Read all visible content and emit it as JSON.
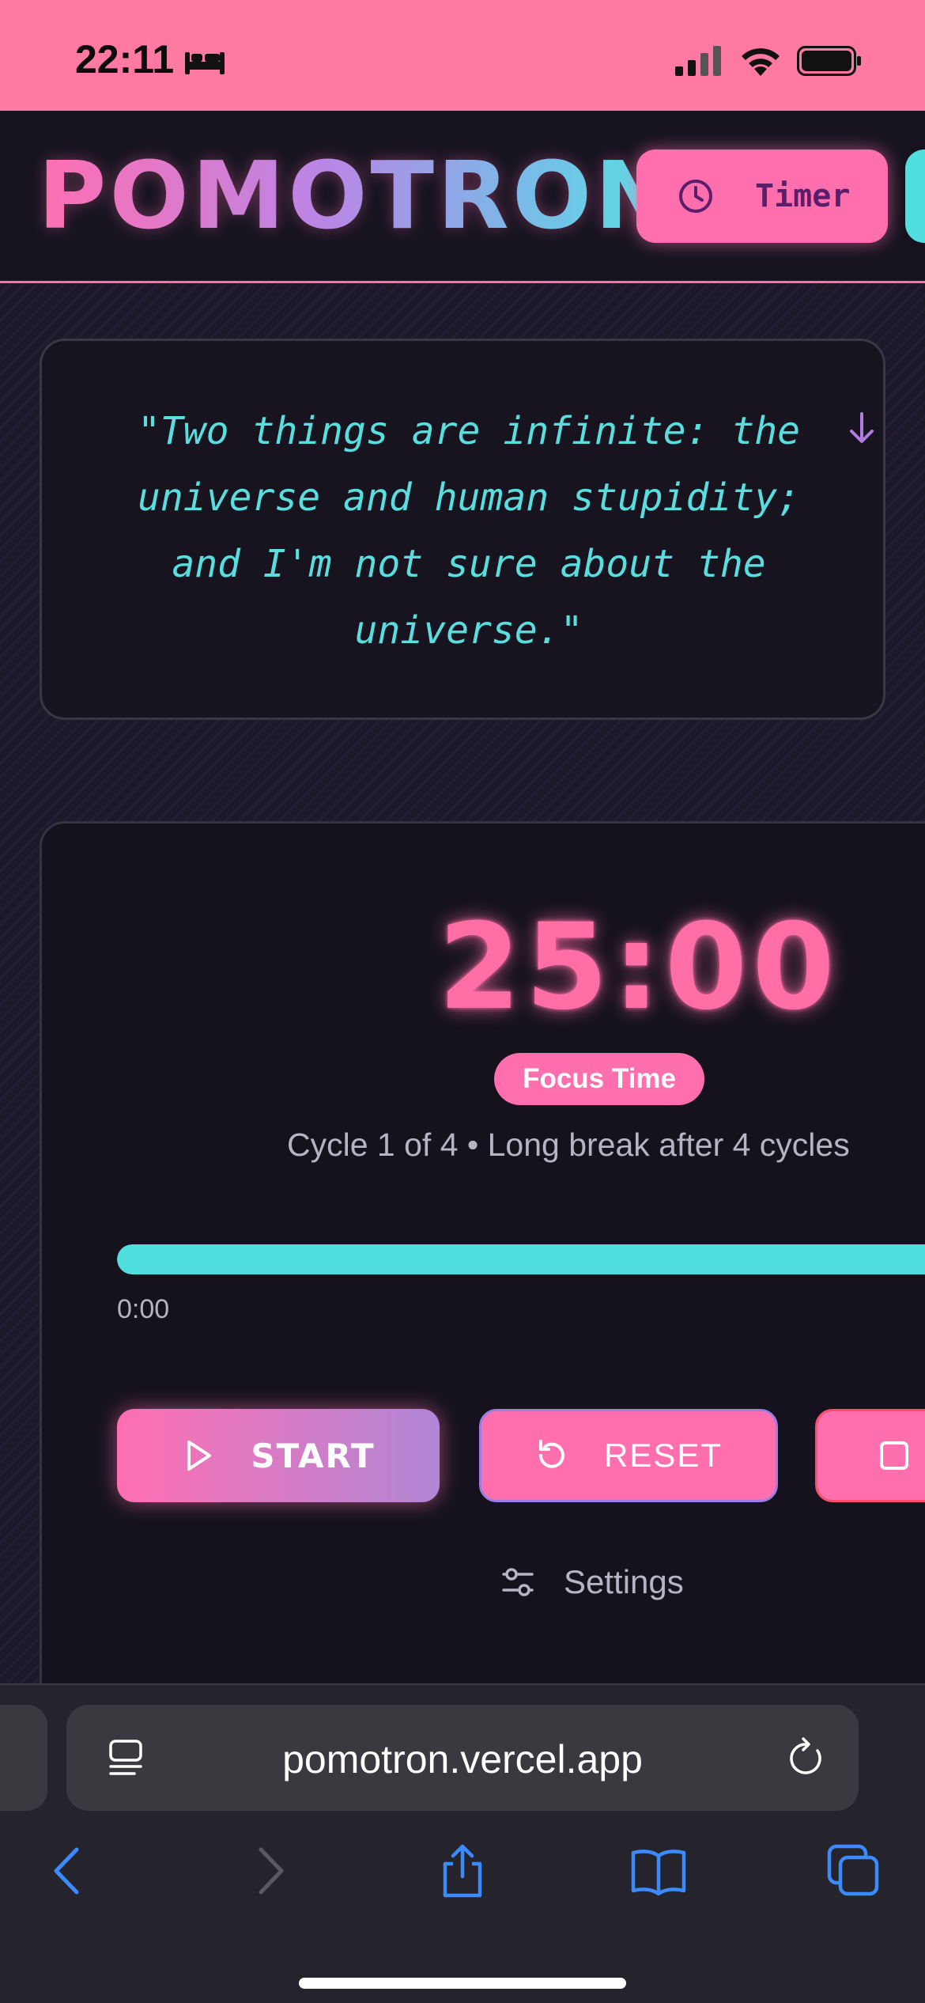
{
  "status_bar": {
    "time": "22:11",
    "icons": [
      "bed-icon",
      "signal-icon",
      "wifi-icon",
      "battery-icon"
    ]
  },
  "header": {
    "brand": "POMOTRON",
    "nav": [
      {
        "label": "Timer",
        "icon": "clock-icon",
        "active": true
      }
    ]
  },
  "quote": {
    "text": "\"Two things are infinite: the universe and human stupidity; and I'm not sure about the universe.\"",
    "icon": "arrow-down-icon"
  },
  "timer": {
    "time": "25:00",
    "mode": "Focus Time",
    "cycle_text": "Cycle 1 of 4 • Long break after 4 cycles",
    "progress_fraction": 1.0,
    "elapsed": "0:00",
    "buttons": {
      "start": "START",
      "reset": "RESET"
    },
    "settings_label": "Settings"
  },
  "browser": {
    "url": "pomotron.vercel.app",
    "toolbar_icons": [
      "back-icon",
      "forward-icon",
      "share-icon",
      "bookmarks-icon",
      "tabs-icon"
    ]
  },
  "colors": {
    "status_bar": "#ff7aa2",
    "accent_pink": "#ff6fae",
    "accent_cyan": "#50dede",
    "accent_purple": "#b086d6",
    "background": "#1a1726"
  }
}
